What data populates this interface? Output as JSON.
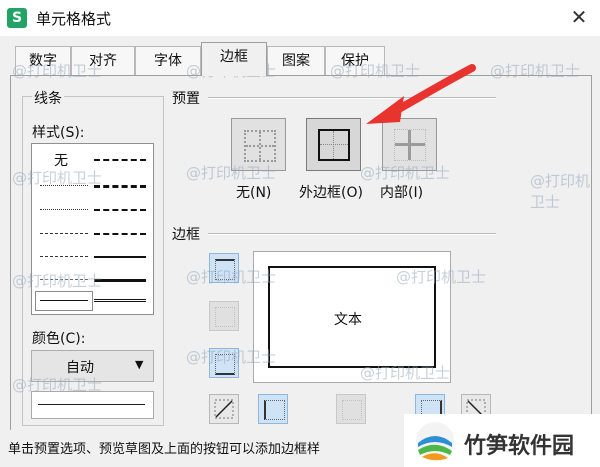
{
  "window": {
    "title": "单元格格式",
    "app_icon": "S",
    "close_glyph": "✕"
  },
  "tabs": [
    {
      "label": "数字",
      "active": false
    },
    {
      "label": "对齐",
      "active": false
    },
    {
      "label": "字体",
      "active": false
    },
    {
      "label": "边框",
      "active": true
    },
    {
      "label": "图案",
      "active": false
    },
    {
      "label": "保护",
      "active": false
    }
  ],
  "line_group": {
    "title": "线条",
    "style_label": "样式(S):",
    "none_label": "无",
    "color_label": "颜色(C):",
    "color_value": "自动",
    "dropdown_arrow": "▼"
  },
  "preset": {
    "title": "预置",
    "buttons": [
      {
        "label": "无(N)",
        "icon": "no-border-icon",
        "selected": false
      },
      {
        "label": "外边框(O)",
        "icon": "outline-border-icon",
        "selected": true
      },
      {
        "label": "内部(I)",
        "icon": "inside-border-icon",
        "selected": false
      }
    ]
  },
  "border": {
    "title": "边框",
    "preview_text": "文本"
  },
  "status": {
    "hint": "单击预置选项、预览草图及上面的按钮可以添加边框样"
  },
  "watermark": {
    "text": "@打印机卫士"
  },
  "brand": {
    "name": "竹笋软件园"
  },
  "colors": {
    "accent_blue": "#cfe3f7",
    "arrow_red": "#e8332f",
    "app_green": "#21a366"
  }
}
